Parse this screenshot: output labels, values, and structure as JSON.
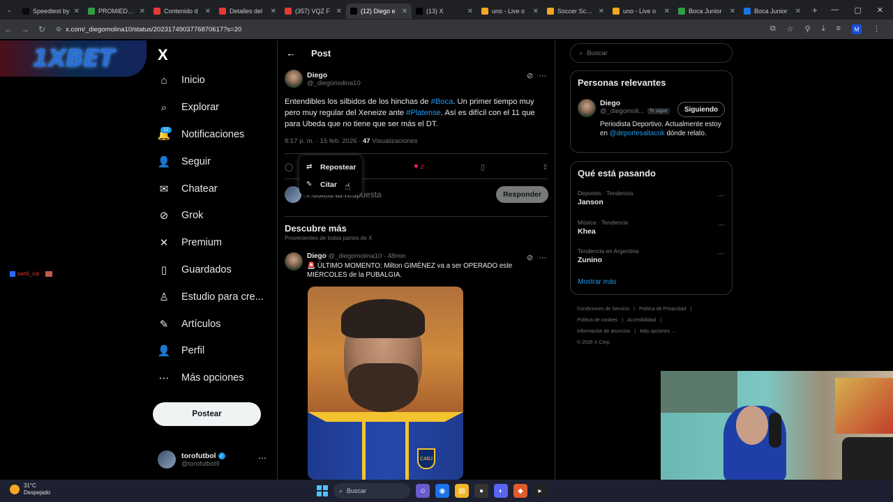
{
  "browser": {
    "tabs": [
      {
        "title": "Speedtest by",
        "color": "#0b0b0b"
      },
      {
        "title": "PROMIEDOS",
        "color": "#2ea043"
      },
      {
        "title": "Contenido d",
        "color": "#e53935"
      },
      {
        "title": "Detalles del",
        "color": "#e53935"
      },
      {
        "title": "(357) VQZ F",
        "color": "#e53935"
      },
      {
        "title": "(12) Diego e",
        "color": "#000000"
      },
      {
        "title": "(13) X",
        "color": "#000000"
      },
      {
        "title": "uno - Live o",
        "color": "#f5a623"
      },
      {
        "title": "Soccer Score",
        "color": "#f5a623"
      },
      {
        "title": "uno - Live o",
        "color": "#f5a623"
      },
      {
        "title": "Boca Junior",
        "color": "#2ea043"
      },
      {
        "title": "Boca Junior",
        "color": "#1a73e8"
      }
    ],
    "active_tab": 5,
    "url": "x.com/_diegomolina10/status/2023174903776870617?s=20",
    "profile_initial": "M"
  },
  "overlay": {
    "bet_logo": "1XBET",
    "chat_name": "santi_cai",
    "chat_sep": ":"
  },
  "nav": {
    "logo": "X",
    "items": [
      {
        "label": "Inicio",
        "icon": "home-icon",
        "glyph": "⌂"
      },
      {
        "label": "Explorar",
        "icon": "search-icon",
        "glyph": "⌕"
      },
      {
        "label": "Notificaciones",
        "icon": "bell-icon",
        "glyph": "🔔"
      },
      {
        "label": "Seguir",
        "icon": "follow-icon",
        "glyph": "👤"
      },
      {
        "label": "Chatear",
        "icon": "mail-icon",
        "glyph": "✉"
      },
      {
        "label": "Grok",
        "icon": "grok-icon",
        "glyph": "⊘"
      },
      {
        "label": "Premium",
        "icon": "x-premium-icon",
        "glyph": "✕"
      },
      {
        "label": "Guardados",
        "icon": "bookmark-icon",
        "glyph": "▯"
      },
      {
        "label": "Estudio para cre...",
        "icon": "studio-icon",
        "glyph": "♙"
      },
      {
        "label": "Artículos",
        "icon": "articles-icon",
        "glyph": "✎"
      },
      {
        "label": "Perfil",
        "icon": "profile-icon",
        "glyph": "👤"
      },
      {
        "label": "Más opciones",
        "icon": "more-icon",
        "glyph": "⋯"
      }
    ],
    "notif_count": "12",
    "post_button": "Postear",
    "me": {
      "name": "torofutbol",
      "handle": "@torofutbol9"
    }
  },
  "post": {
    "header": "Post",
    "author": "Diego",
    "handle": "@_diegomolina10",
    "text_parts": [
      "Entendibles los silbidos de los hinchas de ",
      "#Boca",
      ". Un primer tiempo muy pero muy regular del Xeneize ante ",
      "#Platense",
      ". Así es difícil con el 11 que para Ubeda que no tiene que ser más el DT."
    ],
    "meta_time": "8:17 p. m. · 15 feb. 2026 · ",
    "views_count": "47",
    "views_label": " Visualizaciones",
    "likes": "2",
    "reply_placeholder": "Postea tu respuesta",
    "reply_button": "Responder"
  },
  "popup": {
    "repost": "Repostear",
    "quote": "Citar"
  },
  "discover": {
    "title": "Descubre más",
    "subtitle": "Provenientes de todas partes de X",
    "tweet": {
      "author": "Diego",
      "handle_time": " @_diegomolina10 · 48min",
      "text": "🚨 ÚLTIMO MOMENTO: Milton GIMÉNEZ va a ser OPERADO este MIÉRCOLES de la PUBALGIA."
    }
  },
  "right": {
    "search_placeholder": "Buscar",
    "relevant": {
      "title": "Personas relevantes",
      "name": "Diego",
      "handle": "@_diegomoli...",
      "follows_you": "Te sigue",
      "button": "Siguiendo",
      "bio_before": "Periodista Deportivo. Actualmente estoy en ",
      "bio_mention": "@deportesaltacok",
      "bio_after": " dónde relato."
    },
    "trends_title": "Qué está pasando",
    "trends": [
      {
        "category": "Deportes · Tendencia",
        "topic": "Janson"
      },
      {
        "category": "Música · Tendencia",
        "topic": "Khea"
      },
      {
        "category": "Tendencia en Argentina",
        "topic": "Zunino"
      }
    ],
    "show_more": "Mostrar más",
    "footer": {
      "line1": [
        "Condiciones de Servicio",
        "|",
        "Política de Privacidad",
        "|"
      ],
      "line2": [
        "Política de cookies",
        "|",
        "Accesibilidad",
        "|"
      ],
      "line3": [
        "Información de anuncios",
        "|",
        "Más opciones ..."
      ],
      "line4": "© 2026 X Corp."
    }
  },
  "taskbar": {
    "temp": "31°C",
    "weather": "Despejado",
    "search": "Buscar"
  }
}
